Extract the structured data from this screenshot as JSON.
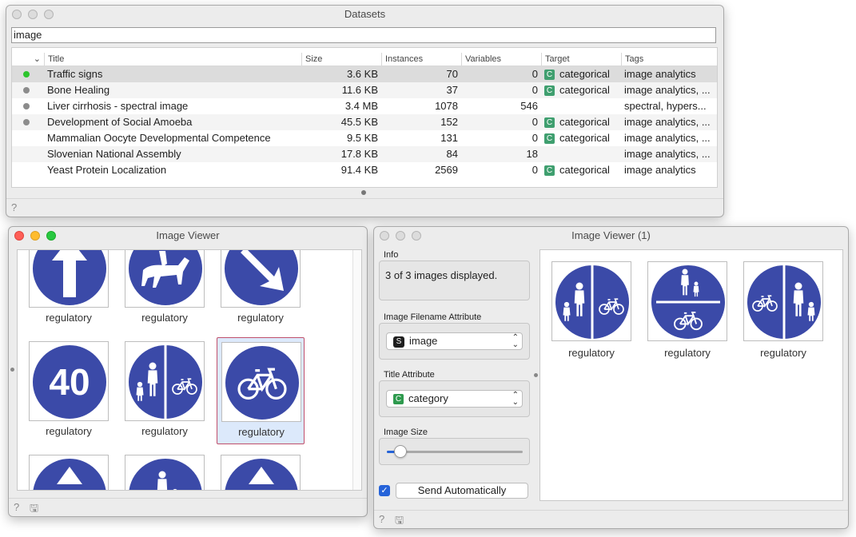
{
  "datasets_window": {
    "title": "Datasets",
    "search_value": "image",
    "columns": [
      "Title",
      "Size",
      "Instances",
      "Variables",
      "Target",
      "Tags"
    ],
    "rows": [
      {
        "status": "green",
        "title": "Traffic signs",
        "size": "3.6 KB",
        "instances": "70",
        "variables": "0",
        "target_type": "C",
        "target": "categorical",
        "tags": "image analytics"
      },
      {
        "status": "gray",
        "title": "Bone Healing",
        "size": "11.6 KB",
        "instances": "37",
        "variables": "0",
        "target_type": "C",
        "target": "categorical",
        "tags": "image analytics, ..."
      },
      {
        "status": "gray",
        "title": "Liver cirrhosis - spectral image",
        "size": "3.4 MB",
        "instances": "1078",
        "variables": "546",
        "target_type": "",
        "target": "",
        "tags": "spectral, hypers..."
      },
      {
        "status": "gray",
        "title": "Development of Social Amoeba",
        "size": "45.5 KB",
        "instances": "152",
        "variables": "0",
        "target_type": "C",
        "target": "categorical",
        "tags": "image analytics, ..."
      },
      {
        "status": "",
        "title": "Mammalian Oocyte Developmental Competence",
        "size": "9.5 KB",
        "instances": "131",
        "variables": "0",
        "target_type": "C",
        "target": "categorical",
        "tags": "image analytics, ..."
      },
      {
        "status": "",
        "title": "Slovenian National Assembly",
        "size": "17.8 KB",
        "instances": "84",
        "variables": "18",
        "target_type": "",
        "target": "",
        "tags": "image analytics, ..."
      },
      {
        "status": "",
        "title": "Yeast Protein Localization",
        "size": "91.4 KB",
        "instances": "2569",
        "variables": "0",
        "target_type": "C",
        "target": "categorical",
        "tags": "image analytics"
      }
    ],
    "status_colors": {
      "green": "#2cc52c",
      "gray": "#8c8c8c"
    },
    "badge_color": "#3f9f6f"
  },
  "image_viewer": {
    "title": "Image Viewer",
    "items": [
      {
        "icon": "arrow-up-sign-icon",
        "caption": "regulatory"
      },
      {
        "icon": "horse-rider-sign-icon",
        "caption": "regulatory"
      },
      {
        "icon": "arrow-down-right-sign-icon",
        "caption": "regulatory"
      },
      {
        "icon": "min-speed-40-sign-icon",
        "caption": "regulatory",
        "sign_text": "40"
      },
      {
        "icon": "pedestrian-bicycle-split-sign-icon",
        "caption": "regulatory"
      },
      {
        "icon": "bicycle-sign-icon",
        "caption": "regulatory",
        "selected": true
      },
      {
        "icon": "partial-sign-icon",
        "caption": ""
      },
      {
        "icon": "partial-pedestrian-sign-icon",
        "caption": ""
      },
      {
        "icon": "partial-sign-icon",
        "caption": ""
      }
    ]
  },
  "image_viewer_1": {
    "title": "Image Viewer (1)",
    "info_label": "Info",
    "info_text": "3 of 3 images displayed.",
    "filename_attr_label": "Image Filename Attribute",
    "filename_attr_type": "S",
    "filename_attr_value": "image",
    "title_attr_label": "Title Attribute",
    "title_attr_type": "C",
    "title_attr_value": "category",
    "image_size_label": "Image Size",
    "image_size_fraction": 0.1,
    "send_auto_checked": true,
    "send_auto_label": "Send Automatically",
    "items": [
      {
        "icon": "pedestrian-bicycle-split-sign-icon",
        "caption": "regulatory"
      },
      {
        "icon": "pedestrian-over-bicycle-sign-icon",
        "caption": "regulatory"
      },
      {
        "icon": "bicycle-pedestrian-split-sign-icon",
        "caption": "regulatory"
      }
    ]
  },
  "colors": {
    "sign_blue": "#3b4aa8",
    "selection_blue": "#dce9fb",
    "checkbox_blue": "#2563d9"
  }
}
